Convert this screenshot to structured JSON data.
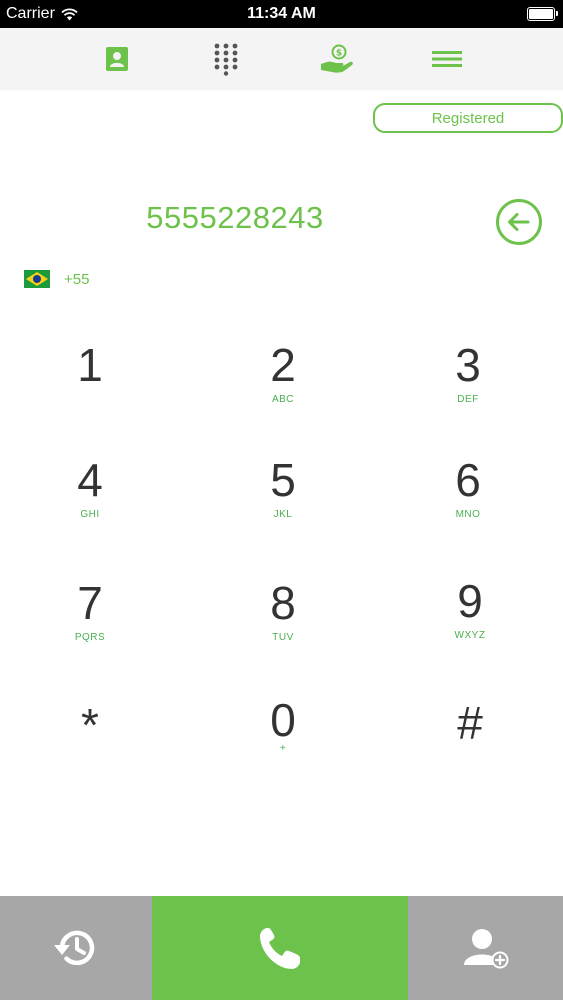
{
  "status_bar": {
    "carrier": "Carrier",
    "time": "11:34 AM",
    "wifi_icon": "wifi-icon",
    "battery_icon": "battery-icon"
  },
  "top_nav": {
    "items": [
      {
        "icon": "contacts-icon"
      },
      {
        "icon": "dialpad-icon"
      },
      {
        "icon": "money-hand-icon"
      },
      {
        "icon": "menu-icon"
      }
    ]
  },
  "registration": {
    "status": "Registered"
  },
  "dialer": {
    "number": "5555228243",
    "backspace_icon": "backspace-icon"
  },
  "country": {
    "flag_icon": "brazil-flag-icon",
    "code": "+55"
  },
  "keypad": {
    "keys": [
      {
        "digit": "1",
        "letters": ""
      },
      {
        "digit": "2",
        "letters": "ABC"
      },
      {
        "digit": "3",
        "letters": "DEF"
      },
      {
        "digit": "4",
        "letters": "GHI"
      },
      {
        "digit": "5",
        "letters": "JKL"
      },
      {
        "digit": "6",
        "letters": "MNO"
      },
      {
        "digit": "7",
        "letters": "PQRS"
      },
      {
        "digit": "8",
        "letters": "TUV"
      },
      {
        "digit": "9",
        "letters": "WXYZ"
      },
      {
        "digit": "*",
        "letters": ""
      },
      {
        "digit": "0",
        "letters": "+"
      },
      {
        "digit": "#",
        "letters": ""
      }
    ]
  },
  "bottom_bar": {
    "history_icon": "history-icon",
    "call_icon": "phone-icon",
    "add_contact_icon": "add-contact-icon"
  },
  "colors": {
    "accent": "#6cc24a",
    "bottom_gray": "#a7a7a7",
    "nav_background": "#f4f4f4"
  }
}
